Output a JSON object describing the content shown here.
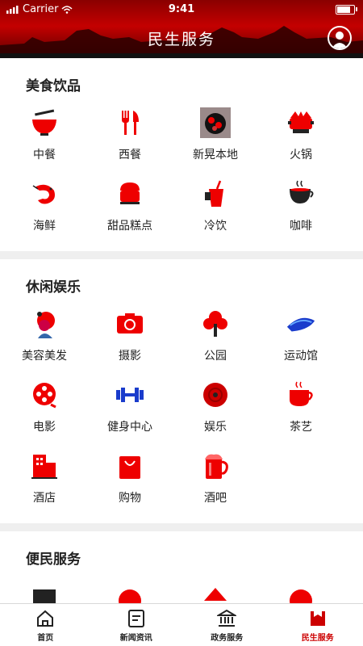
{
  "status": {
    "carrier": "Carrier",
    "time": "9:41"
  },
  "header": {
    "title": "民生服务"
  },
  "sections": [
    {
      "title": "美食饮品",
      "items": [
        {
          "label": "中餐",
          "icon": "bowl-icon"
        },
        {
          "label": "西餐",
          "icon": "fork-knife-icon"
        },
        {
          "label": "新晃本地",
          "icon": "local-food-icon"
        },
        {
          "label": "火锅",
          "icon": "hotpot-icon"
        },
        {
          "label": "海鲜",
          "icon": "shrimp-icon"
        },
        {
          "label": "甜品糕点",
          "icon": "cake-icon"
        },
        {
          "label": "冷饮",
          "icon": "cold-drink-icon"
        },
        {
          "label": "咖啡",
          "icon": "coffee-icon"
        }
      ]
    },
    {
      "title": "休闲娱乐",
      "items": [
        {
          "label": "美容美发",
          "icon": "hair-salon-icon"
        },
        {
          "label": "摄影",
          "icon": "camera-icon"
        },
        {
          "label": "公园",
          "icon": "tree-icon"
        },
        {
          "label": "运动馆",
          "icon": "sports-icon"
        },
        {
          "label": "电影",
          "icon": "film-icon"
        },
        {
          "label": "健身中心",
          "icon": "dumbbell-icon"
        },
        {
          "label": "娱乐",
          "icon": "disc-icon"
        },
        {
          "label": "茶艺",
          "icon": "tea-icon"
        },
        {
          "label": "酒店",
          "icon": "hotel-icon"
        },
        {
          "label": "购物",
          "icon": "shopping-bag-icon"
        },
        {
          "label": "酒吧",
          "icon": "beer-icon"
        }
      ]
    },
    {
      "title": "便民服务",
      "items": [
        {
          "label": "",
          "icon": "service-1-icon"
        },
        {
          "label": "",
          "icon": "service-2-icon"
        },
        {
          "label": "",
          "icon": "service-3-icon"
        },
        {
          "label": "",
          "icon": "service-4-icon"
        }
      ]
    }
  ],
  "tabs": [
    {
      "label": "首页",
      "icon": "home-icon"
    },
    {
      "label": "新闻资讯",
      "icon": "news-icon"
    },
    {
      "label": "政务服务",
      "icon": "government-icon"
    },
    {
      "label": "民生服务",
      "icon": "livelihood-icon",
      "active": true
    }
  ],
  "colors": {
    "accent": "#e00000",
    "dark": "#222222",
    "header": "#b00000"
  }
}
